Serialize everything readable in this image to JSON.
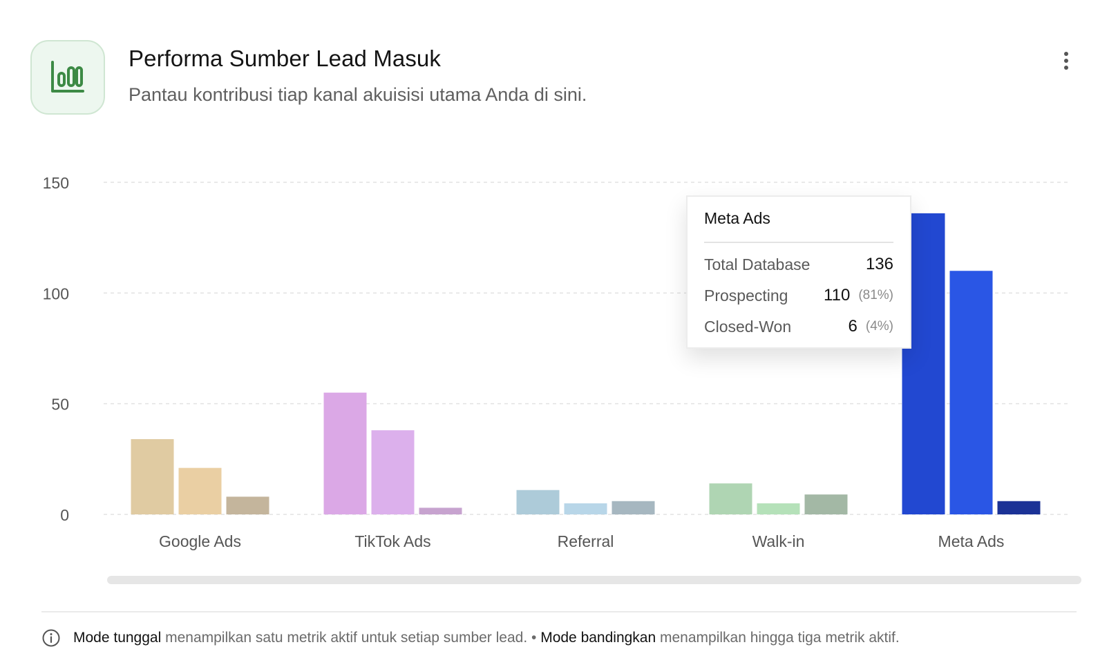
{
  "header": {
    "icon": "bar-chart-icon",
    "title": "Performa Sumber Lead Masuk",
    "subtitle": "Pantau kontribusi tiap kanal akuisisi utama Anda di sini.",
    "menu_icon": "kebab-menu-icon"
  },
  "chart_data": {
    "type": "bar",
    "categories": [
      "Google Ads",
      "TikTok Ads",
      "Referral",
      "Walk-in",
      "Meta Ads"
    ],
    "series": [
      {
        "values": [
          34,
          55,
          11,
          14,
          136
        ]
      },
      {
        "values": [
          21,
          38,
          5,
          5,
          110
        ]
      },
      {
        "values": [
          8,
          3,
          6,
          9,
          6
        ]
      }
    ],
    "colors": [
      [
        "#e0cba2",
        "#eacfa3",
        "#c4b59c"
      ],
      [
        "#dba8e6",
        "#dcb0ec",
        "#c7a3cf"
      ],
      [
        "#adcbd9",
        "#b8d6e8",
        "#a6b7c0"
      ],
      [
        "#afd5b3",
        "#b5e1b9",
        "#a3b8a5"
      ],
      [
        "#2248d1",
        "#2a56e5",
        "#1b3296"
      ]
    ],
    "y_ticks": [
      "0",
      "50",
      "100",
      "150"
    ],
    "ylim": [
      0,
      150
    ],
    "grid": true,
    "legend": "none"
  },
  "tooltip": {
    "title": "Meta Ads",
    "rows": [
      {
        "label": "Total Database",
        "value": "136",
        "pct": ""
      },
      {
        "label": "Prospecting",
        "value": "110",
        "pct": "(81%)"
      },
      {
        "label": "Closed-Won",
        "value": "6",
        "pct": "(4%)"
      }
    ]
  },
  "footnote": {
    "icon": "info-icon",
    "part1_bold": "Mode tunggal",
    "part1_text": " menampilkan satu metrik aktif untuk setiap sumber lead. • ",
    "part2_bold": "Mode bandingkan",
    "part2_text": " menampilkan hingga tiga metrik aktif."
  }
}
